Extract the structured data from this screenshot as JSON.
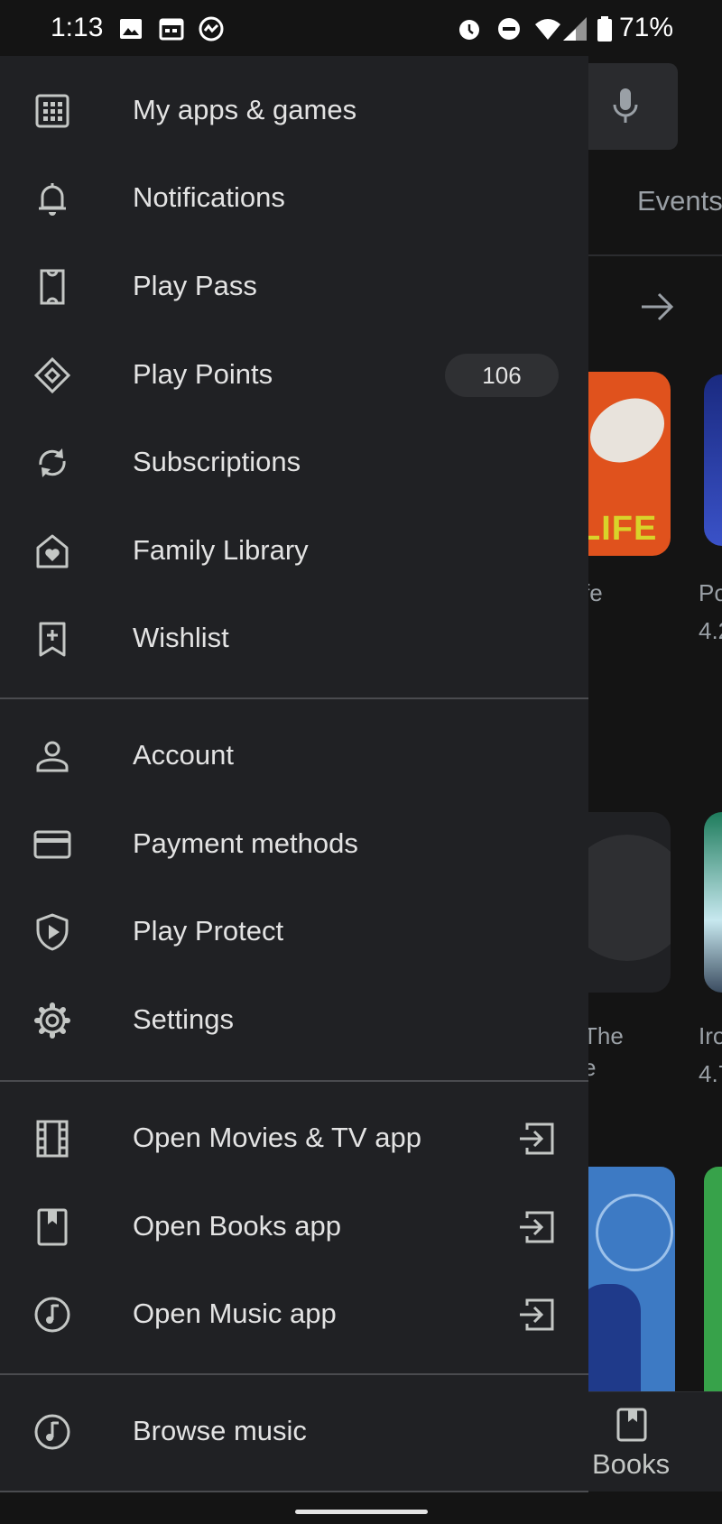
{
  "status_bar": {
    "time": "1:13",
    "battery": "71%",
    "icons": [
      "image-icon",
      "calendar-icon",
      "activity-icon",
      "alarm-icon",
      "do-not-disturb-icon",
      "wifi-icon",
      "signal-icon",
      "battery-icon"
    ]
  },
  "background": {
    "tab_events": "Events",
    "card_texts": [
      "fe",
      "Po",
      "4.2",
      "The",
      "e",
      "Iro",
      "4.7"
    ],
    "card_logo_text": "LIFE",
    "bottom_nav_books": "Books"
  },
  "drawer": {
    "section1": [
      {
        "label": "My apps & games",
        "icon": "apps-grid-icon"
      },
      {
        "label": "Notifications",
        "icon": "bell-icon"
      },
      {
        "label": "Play Pass",
        "icon": "ticket-icon"
      },
      {
        "label": "Play Points",
        "icon": "diamond-icon",
        "badge": "106"
      },
      {
        "label": "Subscriptions",
        "icon": "refresh-icon"
      },
      {
        "label": "Family Library",
        "icon": "family-home-icon"
      },
      {
        "label": "Wishlist",
        "icon": "bookmark-add-icon"
      }
    ],
    "section2": [
      {
        "label": "Account",
        "icon": "person-icon"
      },
      {
        "label": "Payment methods",
        "icon": "credit-card-icon"
      },
      {
        "label": "Play Protect",
        "icon": "shield-play-icon"
      },
      {
        "label": "Settings",
        "icon": "gear-icon"
      }
    ],
    "section3": [
      {
        "label": "Open Movies & TV app",
        "icon": "film-icon",
        "trailing_icon": "open-external-icon"
      },
      {
        "label": "Open Books app",
        "icon": "book-icon",
        "trailing_icon": "open-external-icon"
      },
      {
        "label": "Open Music app",
        "icon": "music-note-icon",
        "trailing_icon": "open-external-icon"
      }
    ],
    "section4": [
      {
        "label": "Browse music",
        "icon": "music-note-icon"
      }
    ]
  },
  "colors": {
    "drawer_bg": "#202124",
    "text": "#e3e3e3",
    "icon": "#c4c7c5",
    "divider": "#4a4b4f",
    "badge_bg": "#2f3033"
  }
}
